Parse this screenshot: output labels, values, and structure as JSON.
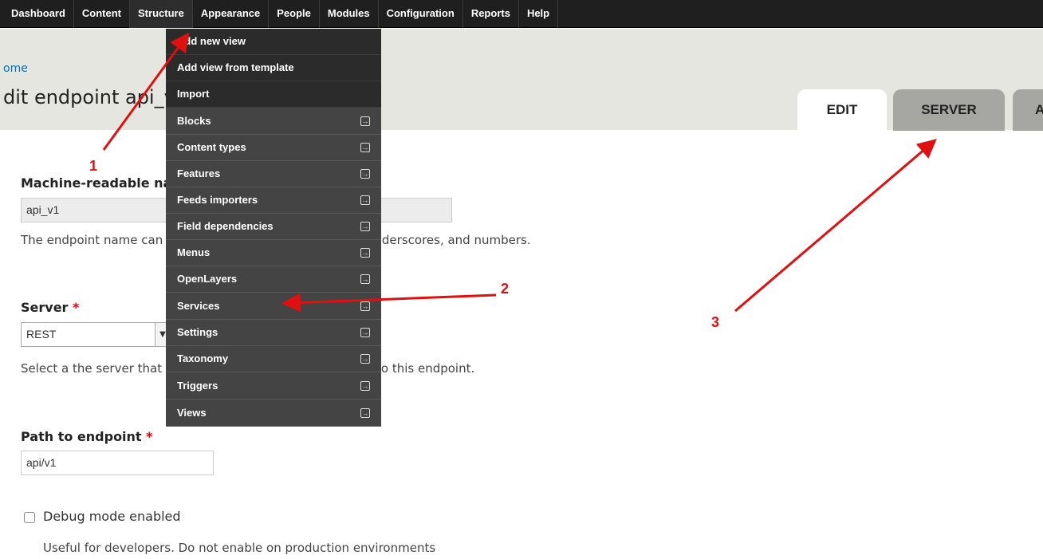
{
  "toolbar": {
    "items": [
      "Dashboard",
      "Content",
      "Structure",
      "Appearance",
      "People",
      "Modules",
      "Configuration",
      "Reports",
      "Help"
    ]
  },
  "breadcrumb": "ome",
  "page_title": "dit endpoint api_v1",
  "tabs": [
    "EDIT",
    "SERVER",
    "A"
  ],
  "dropdown": {
    "items": [
      {
        "label": "Add new view",
        "arrow": false
      },
      {
        "label": "Add view from template",
        "arrow": false
      },
      {
        "label": "Import",
        "arrow": false
      },
      {
        "label": "Blocks",
        "arrow": true
      },
      {
        "label": "Content types",
        "arrow": true
      },
      {
        "label": "Features",
        "arrow": true
      },
      {
        "label": "Feeds importers",
        "arrow": true
      },
      {
        "label": "Field dependencies",
        "arrow": true
      },
      {
        "label": "Menus",
        "arrow": true
      },
      {
        "label": "OpenLayers",
        "arrow": true
      },
      {
        "label": "Services",
        "arrow": true
      },
      {
        "label": "Settings",
        "arrow": true
      },
      {
        "label": "Taxonomy",
        "arrow": true
      },
      {
        "label": "Triggers",
        "arrow": true
      },
      {
        "label": "Views",
        "arrow": true
      }
    ]
  },
  "form": {
    "machine_name": {
      "label": "Machine-readable name of the endpoint",
      "required": "*",
      "value": "api_v1",
      "description": "The endpoint name can only consist of lowercase letters, underscores, and numbers."
    },
    "server": {
      "label": "Server",
      "required": "*",
      "value": "REST",
      "description": "Select a the server that should be used to handle requests to this endpoint."
    },
    "path": {
      "label": "Path to endpoint",
      "required": "*",
      "value": "api/v1"
    },
    "debug": {
      "label": "Debug mode enabled",
      "description": "Useful for developers. Do not enable on production environments"
    }
  },
  "annotations": {
    "labels": [
      "1",
      "2",
      "3"
    ],
    "color": "#e01010"
  }
}
